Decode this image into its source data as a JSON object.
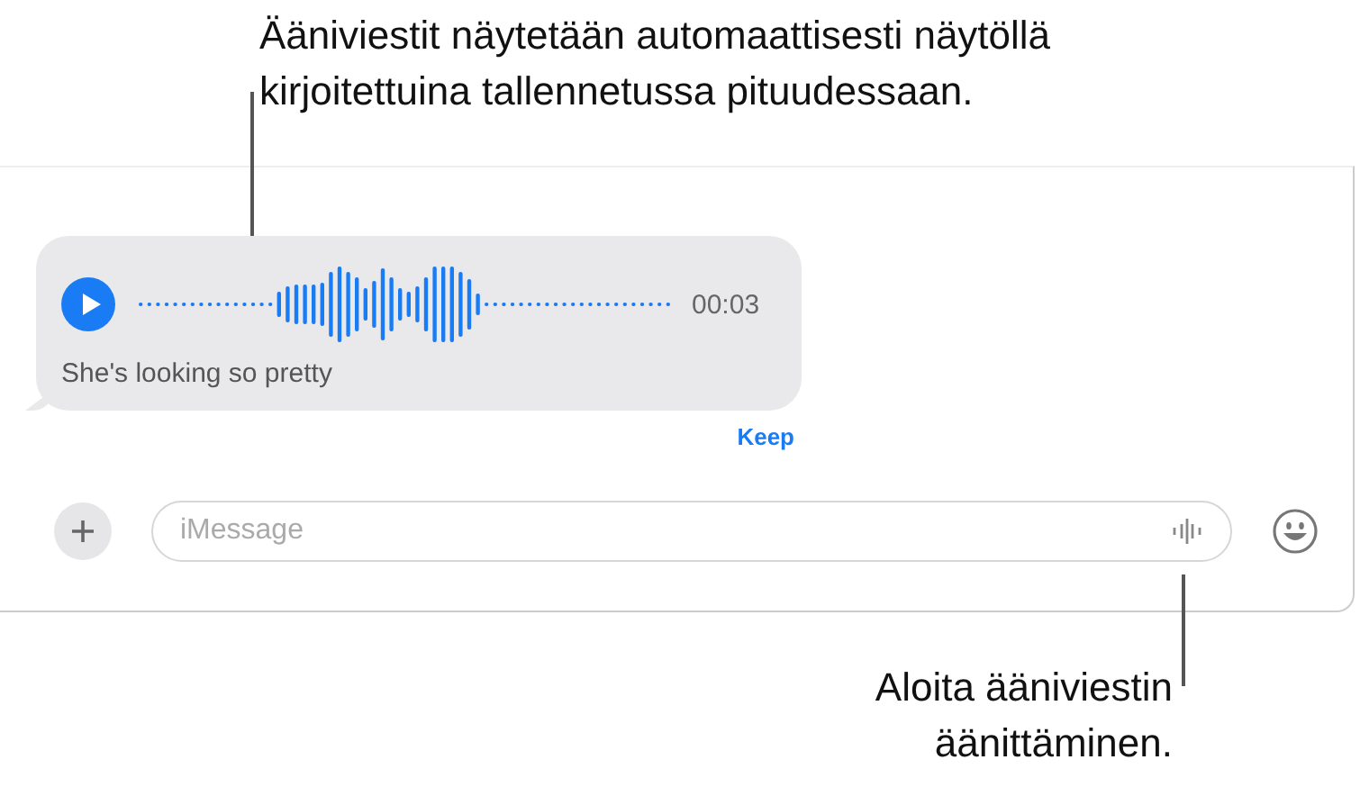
{
  "top_callout": "Ääniviestit näytetään automaattisesti näytöllä kirjoitettuina tallennetussa pituudessaan.",
  "audio_message": {
    "duration": "00:03",
    "transcript": "She's looking so pretty",
    "keep": "Keep"
  },
  "compose": {
    "placeholder": "iMessage"
  },
  "bottom_callout": "Aloita ääniviestin äänittäminen."
}
